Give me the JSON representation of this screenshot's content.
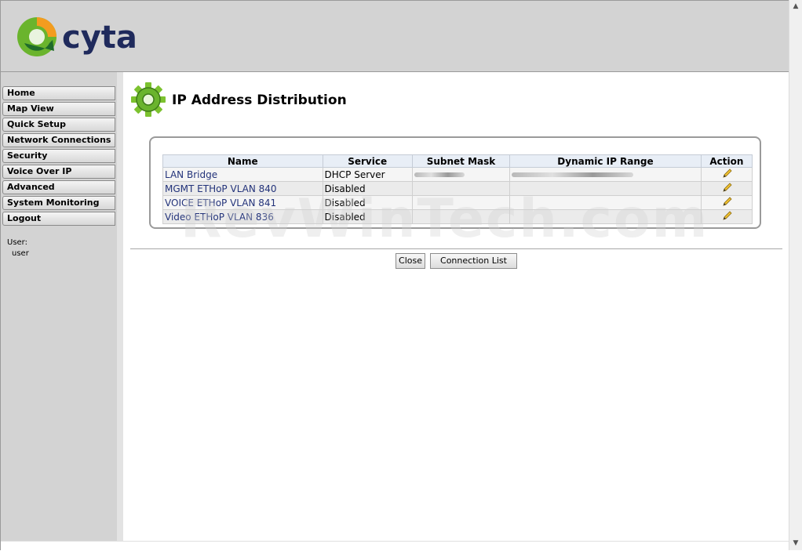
{
  "brand": {
    "logo_text": "cyta"
  },
  "nav": {
    "items": [
      {
        "label": "Home"
      },
      {
        "label": "Map View"
      },
      {
        "label": "Quick Setup"
      },
      {
        "label": "Network Connections"
      },
      {
        "label": "Security"
      },
      {
        "label": "Voice Over IP"
      },
      {
        "label": "Advanced"
      },
      {
        "label": "System Monitoring"
      },
      {
        "label": "Logout"
      }
    ]
  },
  "user": {
    "label": "User:",
    "name": "user"
  },
  "page": {
    "title": "IP Address Distribution",
    "watermark": "RevWinTech.com"
  },
  "table": {
    "headers": {
      "name": "Name",
      "service": "Service",
      "mask": "Subnet Mask",
      "range": "Dynamic IP Range",
      "action": "Action"
    },
    "rows": [
      {
        "name": "LAN Bridge",
        "service": "DHCP Server"
      },
      {
        "name": "MGMT ETHoP VLAN 840",
        "service": "Disabled"
      },
      {
        "name": "VOICE ETHoP VLAN 841",
        "service": "Disabled"
      },
      {
        "name": "Video ETHoP VLAN 836",
        "service": "Disabled"
      }
    ]
  },
  "buttons": {
    "close": "Close",
    "connection_list": "Connection List"
  },
  "colors": {
    "header_bg": "#d3d3d3",
    "link": "#23337a",
    "logo_green": "#6ab42d",
    "logo_orange": "#f39c1f",
    "logo_text": "#1f2a5c"
  }
}
